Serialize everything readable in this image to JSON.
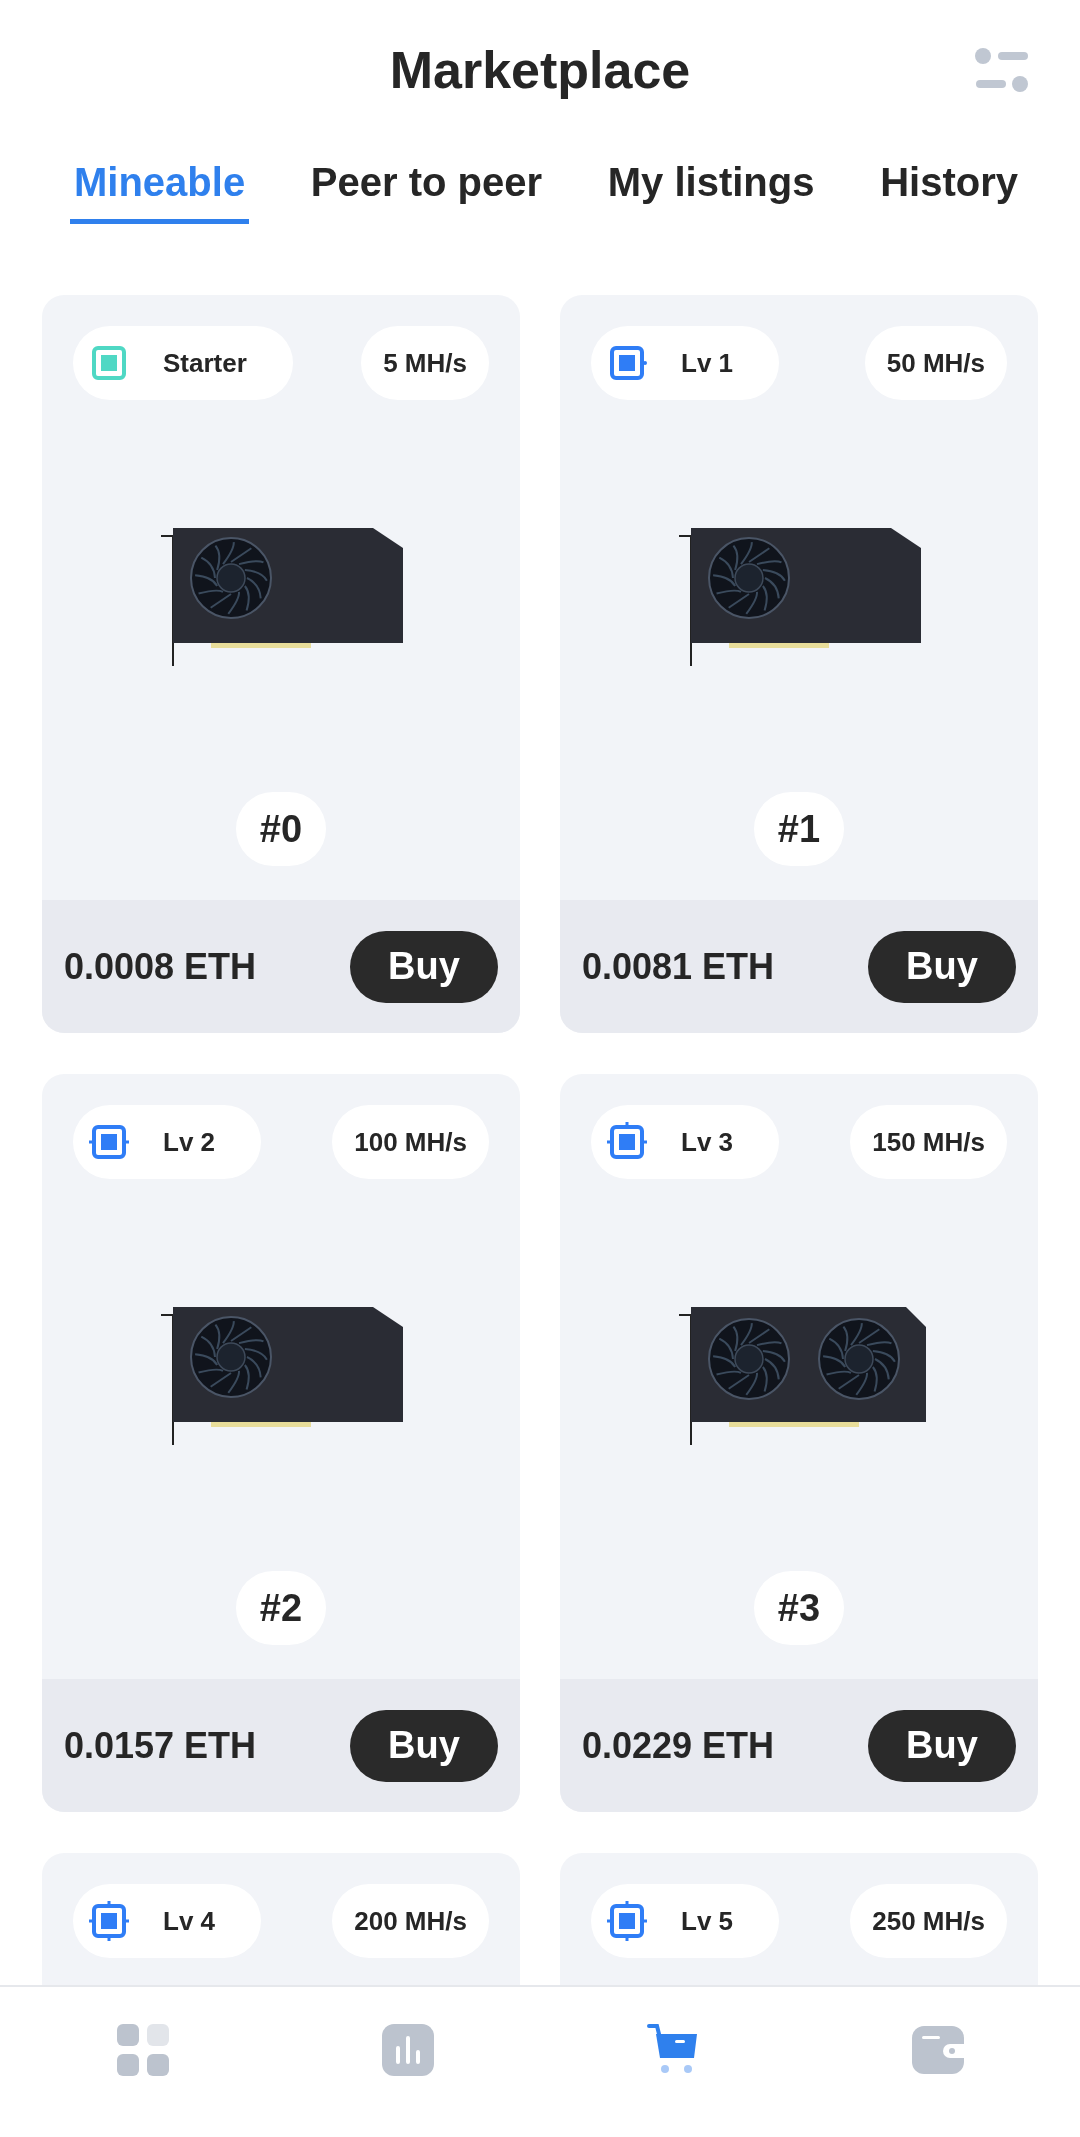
{
  "header": {
    "title": "Marketplace"
  },
  "tabs": [
    {
      "label": "Mineable",
      "selected": true
    },
    {
      "label": "Peer to peer",
      "selected": false
    },
    {
      "label": "My listings",
      "selected": false
    },
    {
      "label": "History",
      "selected": false
    }
  ],
  "cards": [
    {
      "tier": "Starter",
      "hashrate": "5 MH/s",
      "chip": {
        "kind": "starter",
        "color": "#4fd8c4"
      },
      "gpu": {
        "kind": "single-fan"
      },
      "number": "#0",
      "price": "0.0008 ETH",
      "button": "Buy"
    },
    {
      "tier": "Lv 1",
      "hashrate": "50 MH/s",
      "chip": {
        "kind": "pin1",
        "color": "#2f7df6"
      },
      "gpu": {
        "kind": "single-fan"
      },
      "number": "#1",
      "price": "0.0081 ETH",
      "button": "Buy"
    },
    {
      "tier": "Lv 2",
      "hashrate": "100 MH/s",
      "chip": {
        "kind": "pin2",
        "color": "#2f7df6"
      },
      "gpu": {
        "kind": "single-fan"
      },
      "number": "#2",
      "price": "0.0157 ETH",
      "button": "Buy"
    },
    {
      "tier": "Lv 3",
      "hashrate": "150 MH/s",
      "chip": {
        "kind": "pin3",
        "color": "#2f7df6"
      },
      "gpu": {
        "kind": "dual-fan"
      },
      "number": "#3",
      "price": "0.0229 ETH",
      "button": "Buy"
    },
    {
      "tier": "Lv 4",
      "hashrate": "200 MH/s",
      "chip": {
        "kind": "pin4",
        "color": "#2f7df6"
      }
    },
    {
      "tier": "Lv 5",
      "hashrate": "250 MH/s",
      "chip": {
        "kind": "pin4",
        "color": "#2f7df6"
      }
    }
  ],
  "nav": [
    {
      "kind": "dashboard",
      "selected": false
    },
    {
      "kind": "stats",
      "selected": false
    },
    {
      "kind": "market",
      "selected": true
    },
    {
      "kind": "wallet",
      "selected": false
    }
  ]
}
